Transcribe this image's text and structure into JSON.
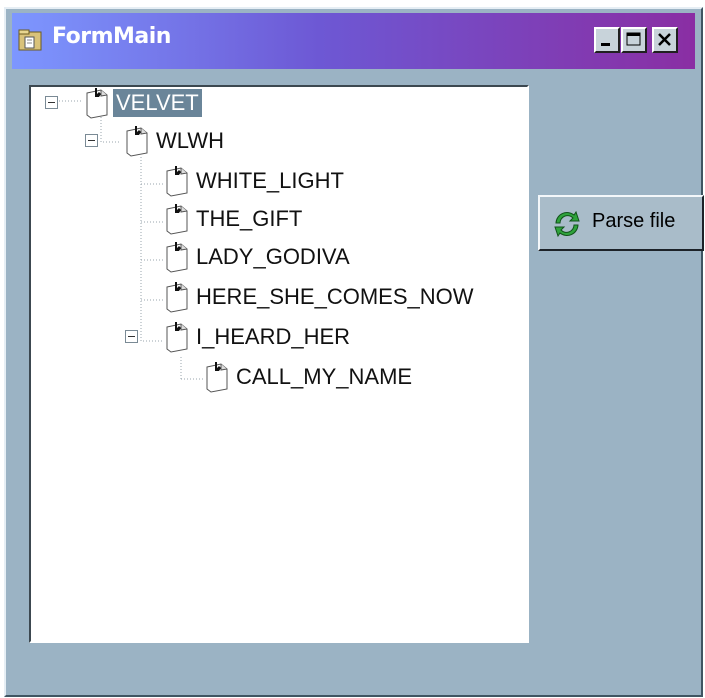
{
  "window": {
    "title": "FormMain",
    "controls": {
      "minimize": "minimize-icon",
      "maximize": "maximize-icon",
      "close": "close-icon"
    }
  },
  "tree": {
    "nodes": [
      {
        "label": "VELVET",
        "level": 0,
        "expanded": true,
        "selected": true
      },
      {
        "label": "WLWH",
        "level": 1,
        "expanded": true
      },
      {
        "label": "WHITE_LIGHT",
        "level": 2
      },
      {
        "label": "THE_GIFT",
        "level": 2
      },
      {
        "label": "LADY_GODIVA",
        "level": 2
      },
      {
        "label": "HERE_SHE_COMES_NOW",
        "level": 2
      },
      {
        "label": "I_HEARD_HER",
        "level": 2,
        "expanded": true
      },
      {
        "label": "CALL_MY_NAME",
        "level": 3
      }
    ]
  },
  "parse_button": {
    "label": "Parse file",
    "icon": "refresh-icon"
  },
  "colors": {
    "title_gradient_start": "#7d97ff",
    "title_gradient_end": "#8a2ea3",
    "window_bg": "#9bb3c4",
    "selection_bg": "#6a8599"
  }
}
